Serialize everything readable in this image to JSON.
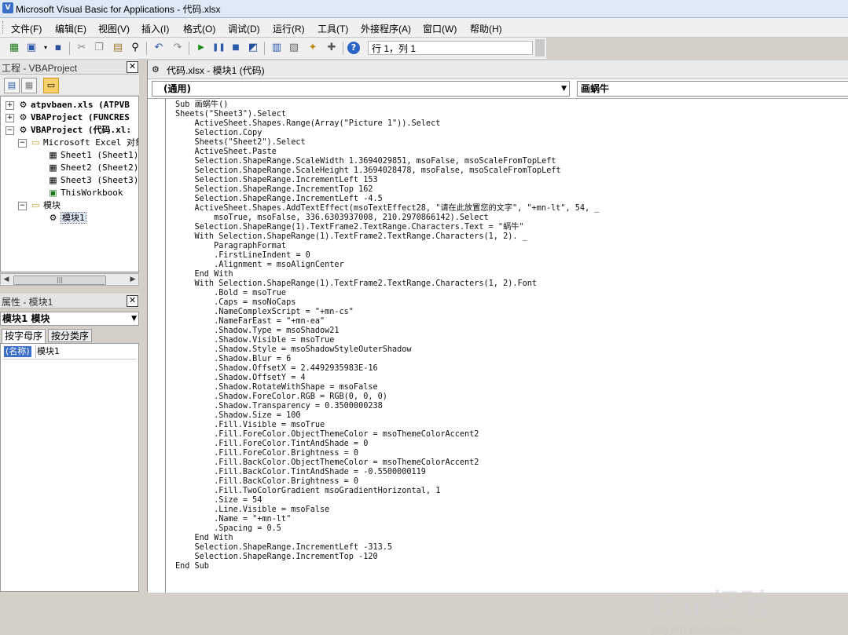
{
  "window": {
    "title": "Microsoft Visual Basic for Applications - 代码.xlsx"
  },
  "menu": [
    "文件(F)",
    "编辑(E)",
    "视图(V)",
    "插入(I)",
    "格式(O)",
    "调试(D)",
    "运行(R)",
    "工具(T)",
    "外接程序(A)",
    "窗口(W)",
    "帮助(H)"
  ],
  "toolbar": {
    "position": "行 1，列 1"
  },
  "project": {
    "title": "工程 - VBAProject",
    "nodes": [
      {
        "label": "atpvbaen.xls (ATPVB"
      },
      {
        "label": "VBAProject (FUNCRES"
      },
      {
        "label": "VBAProject (代码.xl:"
      },
      {
        "label": "Microsoft Excel 对象"
      },
      {
        "label": "Sheet1 (Sheet1)"
      },
      {
        "label": "Sheet2 (Sheet2)"
      },
      {
        "label": "Sheet3 (Sheet3)"
      },
      {
        "label": "ThisWorkbook"
      },
      {
        "label": "模块"
      },
      {
        "label": "模块1"
      }
    ]
  },
  "properties": {
    "title": "属性 - 模块1",
    "combo": "模块1 模块",
    "tabs": [
      "按字母序",
      "按分类序"
    ],
    "name_key": "(名称)",
    "name_value": "模块1"
  },
  "code_window": {
    "title": "代码.xlsx - 模块1 (代码)",
    "object_combo": "(通用)",
    "proc_combo": "画蜗牛",
    "lines": [
      "Sub 画蜗牛()",
      "Sheets(\"Sheet3\").Select",
      "    ActiveSheet.Shapes.Range(Array(\"Picture 1\")).Select",
      "    Selection.Copy",
      "    Sheets(\"Sheet2\").Select",
      "    ActiveSheet.Paste",
      "    Selection.ShapeRange.ScaleWidth 1.3694029851, msoFalse, msoScaleFromTopLeft",
      "    Selection.ShapeRange.ScaleHeight 1.3694028478, msoFalse, msoScaleFromTopLeft",
      "    Selection.ShapeRange.IncrementLeft 153",
      "    Selection.ShapeRange.IncrementTop 162",
      "    Selection.ShapeRange.IncrementLeft -4.5",
      "    ActiveSheet.Shapes.AddTextEffect(msoTextEffect28, \"请在此放置您的文字\", \"+mn-lt\", 54, _",
      "        msoTrue, msoFalse, 336.6303937008, 210.2970866142).Select",
      "    Selection.ShapeRange(1).TextFrame2.TextRange.Characters.Text = \"蜗牛\"",
      "    With Selection.ShapeRange(1).TextFrame2.TextRange.Characters(1, 2). _",
      "        ParagraphFormat",
      "        .FirstLineIndent = 0",
      "        .Alignment = msoAlignCenter",
      "    End With",
      "    With Selection.ShapeRange(1).TextFrame2.TextRange.Characters(1, 2).Font",
      "        .Bold = msoTrue",
      "        .Caps = msoNoCaps",
      "        .NameComplexScript = \"+mn-cs\"",
      "        .NameFarEast = \"+mn-ea\"",
      "        .Shadow.Type = msoShadow21",
      "        .Shadow.Visible = msoTrue",
      "        .Shadow.Style = msoShadowStyleOuterShadow",
      "        .Shadow.Blur = 6",
      "        .Shadow.OffsetX = 2.4492935983E-16",
      "        .Shadow.OffsetY = 4",
      "        .Shadow.RotateWithShape = msoFalse",
      "        .Shadow.ForeColor.RGB = RGB(0, 0, 0)",
      "        .Shadow.Transparency = 0.3500000238",
      "        .Shadow.Size = 100",
      "        .Fill.Visible = msoTrue",
      "        .Fill.ForeColor.ObjectThemeColor = msoThemeColorAccent2",
      "        .Fill.ForeColor.TintAndShade = 0",
      "        .Fill.ForeColor.Brightness = 0",
      "        .Fill.BackColor.ObjectThemeColor = msoThemeColorAccent2",
      "        .Fill.BackColor.TintAndShade = -0.5500000119",
      "        .Fill.BackColor.Brightness = 0",
      "        .Fill.TwoColorGradient msoGradientHorizontal, 1",
      "        .Size = 54",
      "        .Line.Visible = msoFalse",
      "        .Name = \"+mn-lt\"",
      "        .Spacing = 0.5",
      "    End With",
      "    Selection.ShapeRange.IncrementLeft -313.5",
      "    Selection.ShapeRange.IncrementTop -120",
      "End Sub"
    ]
  },
  "watermark": {
    "brand": "Bai 经验",
    "url": "jingyan.baidu.com"
  }
}
